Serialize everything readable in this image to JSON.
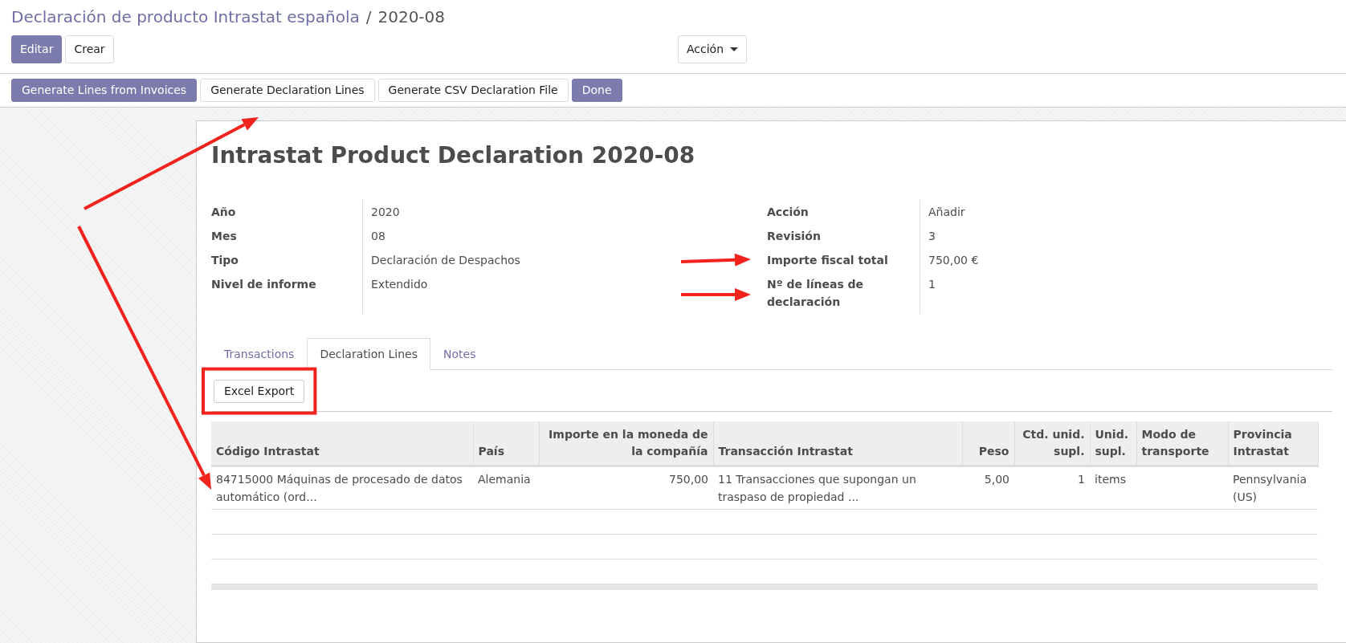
{
  "breadcrumb": {
    "parent": "Declaración de producto Intrastat española",
    "separator": "/",
    "current": "2020-08"
  },
  "control_buttons": [
    {
      "label": "Editar",
      "kind": "primary"
    },
    {
      "label": "Crear",
      "kind": "secondary"
    }
  ],
  "action_menu": {
    "label": "Acción"
  },
  "header_buttons": [
    {
      "label": "Generate Lines from Invoices",
      "kind": "primary"
    },
    {
      "label": "Generate Declaration Lines",
      "kind": "secondary"
    },
    {
      "label": "Generate CSV Declaration File",
      "kind": "secondary"
    },
    {
      "label": "Done",
      "kind": "primary"
    }
  ],
  "sheet": {
    "title": "Intrastat Product Declaration 2020-08",
    "left_fields": [
      {
        "label": "Año",
        "value": "2020"
      },
      {
        "label": "Mes",
        "value": "08"
      },
      {
        "label": "Tipo",
        "value": "Declaración de Despachos"
      },
      {
        "label": "Nivel de informe",
        "value": "Extendido"
      }
    ],
    "right_fields": [
      {
        "label": "Acción",
        "value": "Añadir"
      },
      {
        "label": "Revisión",
        "value": "3"
      },
      {
        "label": "Importe fiscal total",
        "value": "750,00 €"
      },
      {
        "label": "Nº de líneas de declaración",
        "value": "1"
      }
    ]
  },
  "tabs": [
    {
      "label": "Transactions",
      "selected": false
    },
    {
      "label": "Declaration Lines",
      "selected": true
    },
    {
      "label": "Notes",
      "selected": false
    }
  ],
  "tab_buttons": [
    "Excel Export"
  ],
  "table": {
    "columns": [
      {
        "label": "Código Intrastat",
        "numeric": false
      },
      {
        "label": "País",
        "numeric": false
      },
      {
        "label": "Importe en la moneda de la compañía",
        "numeric": true
      },
      {
        "label": "Transacción Intrastat",
        "numeric": false
      },
      {
        "label": "Peso",
        "numeric": true
      },
      {
        "label": "Ctd. unid. supl.",
        "numeric": true
      },
      {
        "label": "Unid. supl.",
        "numeric": false
      },
      {
        "label": "Modo de transporte",
        "numeric": false
      },
      {
        "label": "Provincia Intrastat",
        "numeric": false
      }
    ],
    "rows": [
      {
        "cells": [
          "84715000 Máquinas de procesado de datos automático (ord...",
          "Alemania",
          "750,00",
          "11 Transacciones que supongan un traspaso de propiedad ...",
          "5,00",
          "1",
          "items",
          "",
          "Pennsylvania (US)"
        ]
      }
    ]
  },
  "annotations": [
    {
      "kind": "arrow"
    },
    {
      "kind": "arrow"
    },
    {
      "kind": "arrow"
    },
    {
      "kind": "arrow"
    },
    {
      "kind": "highlight-box"
    }
  ]
}
